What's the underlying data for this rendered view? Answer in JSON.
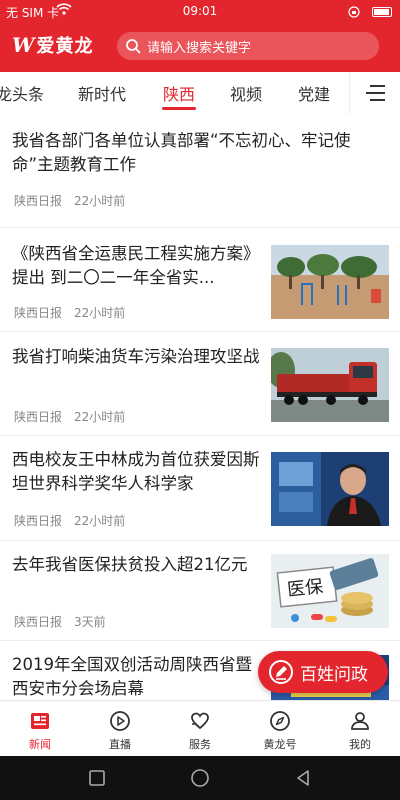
{
  "status_bar": {
    "carrier": "无 SIM 卡",
    "time": "09:01"
  },
  "header": {
    "logo_text": "爱黄龙",
    "search_placeholder": "请输入搜索关键字",
    "brand_color": "#e3262d"
  },
  "tabs": [
    {
      "label": "龙头条"
    },
    {
      "label": "新时代"
    },
    {
      "label": "陕西",
      "active": true
    },
    {
      "label": "视频"
    },
    {
      "label": "党建"
    }
  ],
  "feed": [
    {
      "title": "我省各部门各单位认真部署“不忘初心、牢记使命”主题教育工作",
      "source": "陕西日报",
      "time": "22小时前"
    },
    {
      "title": "《陕西省全运惠民工程实施方案》提出 到二〇二一年全省实...",
      "source": "陕西日报",
      "time": "22小时前",
      "thumb": "park-fitness-image"
    },
    {
      "title": "我省打响柴油货车污染治理攻坚战",
      "source": "陕西日报",
      "time": "22小时前",
      "thumb": "red-truck-image"
    },
    {
      "title": "西电校友王中林成为首位获爱因斯坦世界科学奖华人科学家",
      "source": "陕西日报",
      "time": "22小时前",
      "thumb": "scientist-portrait-image"
    },
    {
      "title": "去年我省医保扶贫投入超21亿元",
      "source": "陕西日报",
      "time": "3天前",
      "thumb": "medical-insurance-image"
    },
    {
      "title": "2019年全国双创活动周陕西省暨西安市分会场启幕",
      "thumb": "event-banner-image"
    }
  ],
  "thumb_captions": {
    "medical_insurance": "医保"
  },
  "fab": {
    "label": "百姓问政"
  },
  "bottom_nav": [
    {
      "label": "新闻",
      "icon": "news-icon",
      "active": true
    },
    {
      "label": "直播",
      "icon": "play-icon"
    },
    {
      "label": "服务",
      "icon": "service-heart-icon"
    },
    {
      "label": "黄龙号",
      "icon": "compass-icon"
    },
    {
      "label": "我的",
      "icon": "user-icon"
    }
  ]
}
